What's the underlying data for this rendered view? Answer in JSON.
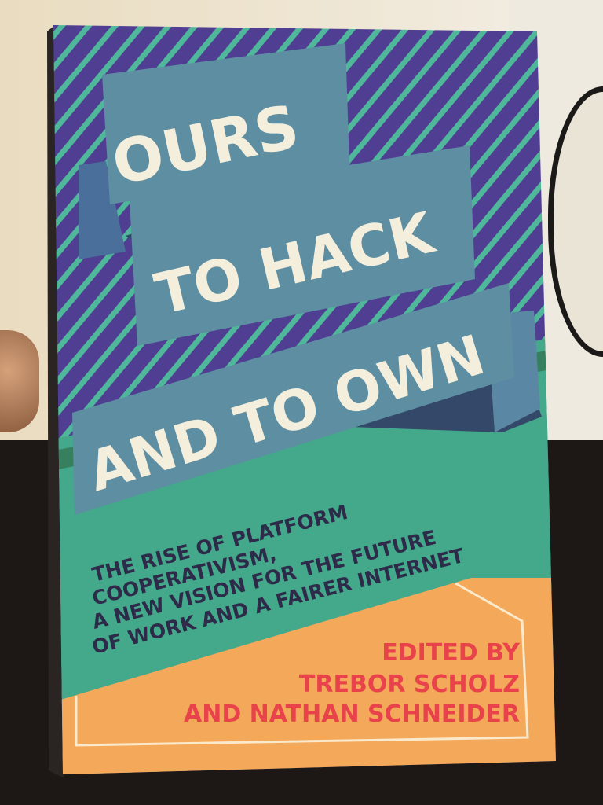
{
  "book": {
    "title_lines": [
      "OURS",
      "TO HACK",
      "AND TO OWN"
    ],
    "subtitle_lines": [
      "THE RISE OF PLATFORM",
      "COOPERATIVISM,",
      "A NEW VISION FOR THE FUTURE",
      "OF WORK AND A FAIRER INTERNET"
    ],
    "credit_lines": [
      "EDITED BY",
      "TREBOR SCHOLZ",
      "AND NATHAN SCHNEIDER"
    ]
  },
  "colors": {
    "stripe_purple": "#4f3e92",
    "stripe_teal": "#4fb79a",
    "banner": "#5d8ea2",
    "banner_shadow": "#34486a",
    "title_text": "#f4eedc",
    "green_band": "#44a88a",
    "subtitle_text": "#2e2a4a",
    "orange": "#f4a85a",
    "credit_text": "#e8434a"
  }
}
